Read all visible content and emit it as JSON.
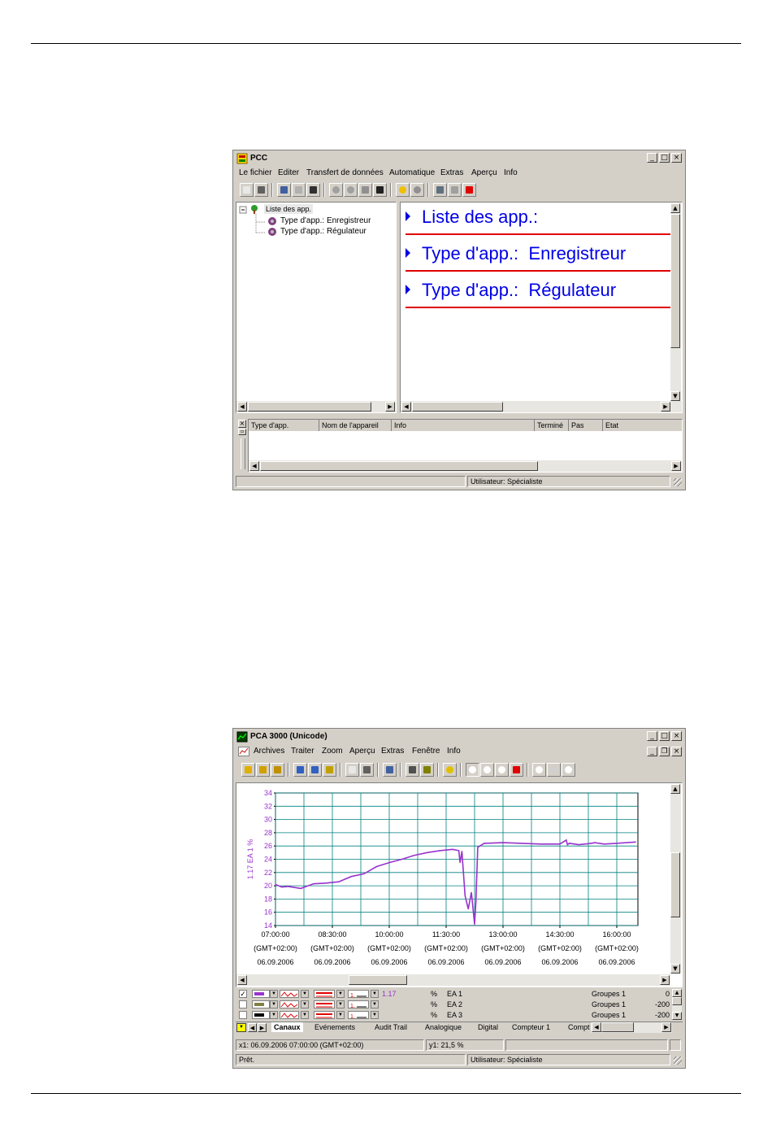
{
  "window1": {
    "title": "PCC",
    "menu": [
      "Le fichier",
      "Editer",
      "Transfert de données",
      "Automatique",
      "Extras",
      "Aperçu",
      "Info"
    ],
    "tree": {
      "root": "Liste des app.",
      "children": [
        "Type d'app.: Enregistreur",
        "Type d'app.: Régulateur"
      ]
    },
    "overview_rows": [
      "Liste des app.:",
      "Type d'app.:  Enregistreur",
      "Type d'app.:  Régulateur"
    ],
    "list_columns": [
      "Type d'app.",
      "Nom de l'appareil",
      "Info",
      "Terminé",
      "Pas",
      "Etat"
    ],
    "status_user": "Utilisateur: Spécialiste",
    "accent_color": "#0000e6",
    "line_color": "#e00000"
  },
  "window2": {
    "title": "PCA 3000 (Unicode)",
    "menu": [
      "Archives",
      "Traiter",
      "Zoom",
      "Aperçu",
      "Extras",
      "Fenêtre",
      "Info"
    ],
    "channels": [
      {
        "checked": true,
        "color": "#9933cc",
        "value": "1.17",
        "unit": "%",
        "name": "EA 1",
        "group": "Groupes 1",
        "num": "0"
      },
      {
        "checked": false,
        "color": "#808040",
        "value": "",
        "unit": "%",
        "name": "EA 2",
        "group": "Groupes 1",
        "num": "-200"
      },
      {
        "checked": false,
        "color": "#000000",
        "value": "",
        "unit": "%",
        "name": "EA 3",
        "group": "Groupes 1",
        "num": "-200"
      }
    ],
    "tabs": [
      "Canaux",
      "Evénements",
      "Audit Trail",
      "Analogique",
      "Digital",
      "Compteur 1",
      "Compt"
    ],
    "cursor_x": "x1: 06.09.2006 07:00:00 (GMT+02:00)",
    "cursor_y": "y1: 21,5 %",
    "status_ready": "Prêt.",
    "status_user": "Utilisateur: Spécialiste"
  },
  "chart_data": {
    "type": "line",
    "ylabel": "1.17 EA 1 %",
    "ylim": [
      14,
      34
    ],
    "yticks": [
      14,
      16,
      18,
      20,
      22,
      24,
      26,
      28,
      30,
      32,
      34
    ],
    "x_tick_times": [
      "07:00:00",
      "08:30:00",
      "10:00:00",
      "11:30:00",
      "13:00:00",
      "14:30:00",
      "16:00:00"
    ],
    "x_tick_zone": "(GMT+02:00)",
    "x_tick_date": "06.09.2006",
    "grid": true,
    "series": [
      {
        "color": "#9933cc",
        "x": [
          "07:00",
          "07:10",
          "07:20",
          "07:40",
          "08:00",
          "08:20",
          "08:40",
          "09:00",
          "09:20",
          "09:40",
          "10:00",
          "10:20",
          "10:40",
          "11:00",
          "11:20",
          "11:40",
          "11:50",
          "11:52",
          "11:55",
          "12:00",
          "12:05",
          "12:10",
          "12:15",
          "12:17",
          "12:20",
          "12:30",
          "13:00",
          "13:30",
          "14:00",
          "14:30",
          "14:40",
          "14:42",
          "14:45",
          "15:00",
          "15:20",
          "15:25",
          "15:40",
          "16:00",
          "16:30"
        ],
        "y": [
          20.2,
          19.8,
          19.9,
          19.6,
          20.3,
          20.4,
          20.6,
          21.4,
          21.8,
          22.9,
          23.5,
          24.0,
          24.6,
          25.0,
          25.3,
          25.5,
          25.3,
          23.5,
          25.2,
          18.5,
          16.5,
          19.0,
          14.2,
          17.5,
          25.8,
          26.4,
          26.5,
          26.4,
          26.3,
          26.3,
          26.9,
          26.2,
          26.4,
          26.2,
          26.4,
          26.5,
          26.3,
          26.4,
          26.6
        ]
      }
    ]
  }
}
